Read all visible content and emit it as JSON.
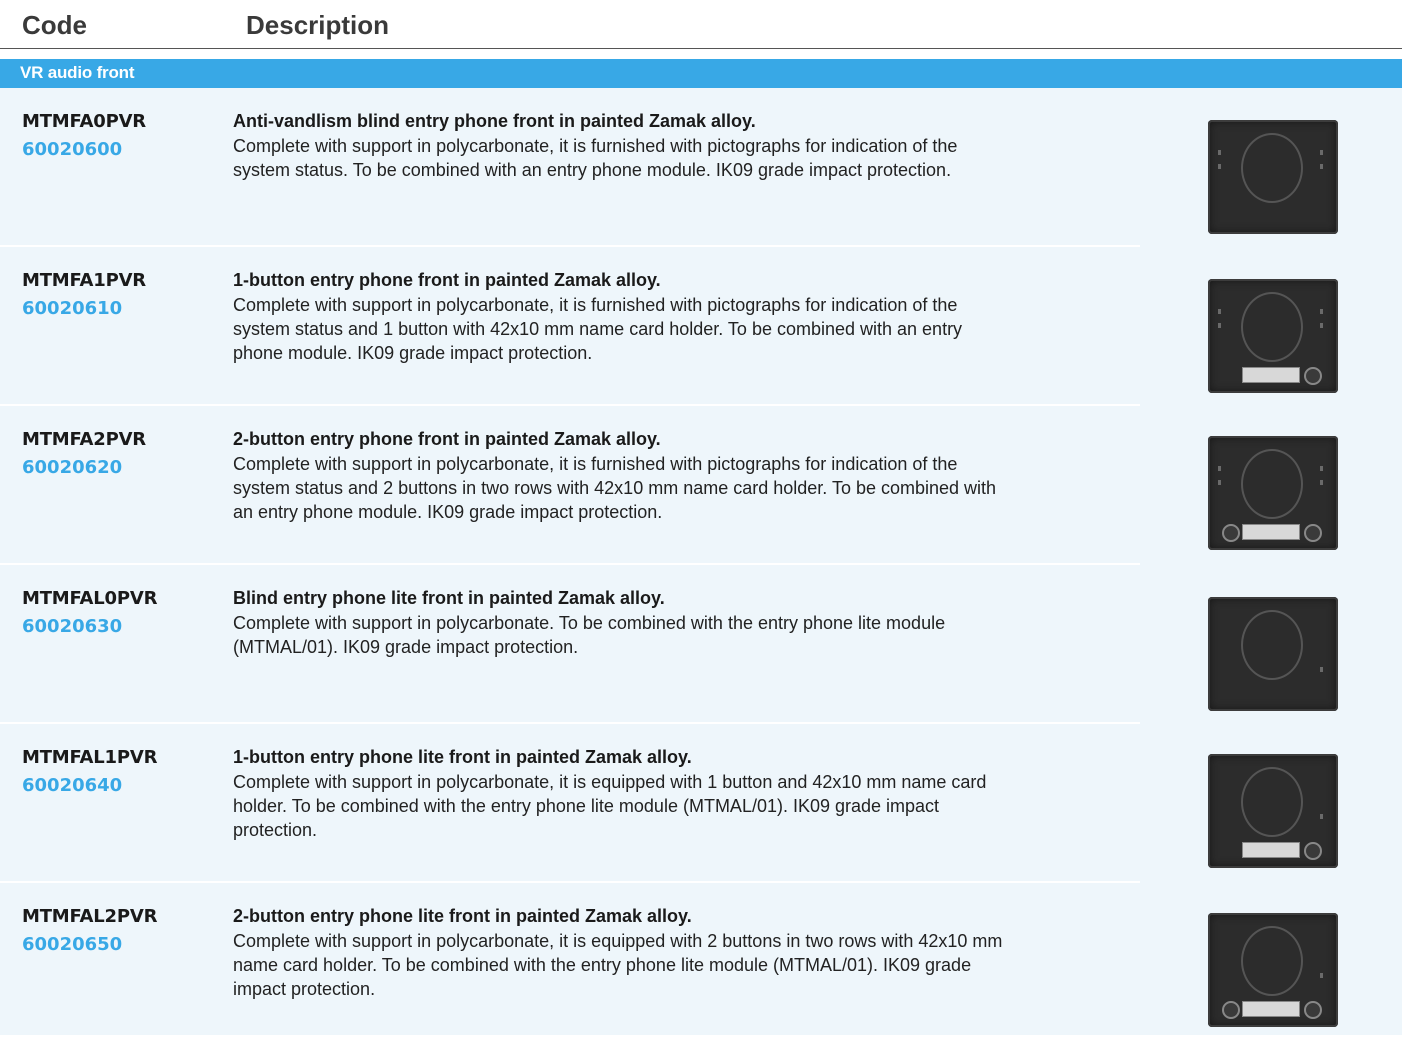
{
  "header": {
    "code_label": "Code",
    "description_label": "Description"
  },
  "section": {
    "title": "VR audio front"
  },
  "products": [
    {
      "code": "MTMFA0PVR",
      "number": "60020600",
      "title": "Anti-vandlism blind entry phone front in painted Zamak alloy.",
      "description": "Complete with support in polycarbonate, it is furnished with pictographs for indication of the system status. To be combined with an entry phone module. IK09 grade impact protection.",
      "image": "blind-front-photo"
    },
    {
      "code": "MTMFA1PVR",
      "number": "60020610",
      "title": "1-button entry phone front in painted Zamak alloy.",
      "description": "Complete with support in polycarbonate, it is furnished with pictographs for indication of the system status and 1 button with 42x10 mm name card holder. To be combined with an entry phone module. IK09 grade impact protection.",
      "image": "one-button-front-photo"
    },
    {
      "code": "MTMFA2PVR",
      "number": "60020620",
      "title": "2-button entry phone front in painted Zamak alloy.",
      "description": "Complete with support in polycarbonate, it is furnished with pictographs for indication of the system status and 2 buttons in two rows with 42x10 mm name card holder. To be combined with an entry phone module. IK09 grade impact protection.",
      "image": "two-button-front-photo"
    },
    {
      "code": "MTMFAL0PVR",
      "number": "60020630",
      "title": "Blind entry phone lite front in painted Zamak alloy.",
      "description": "Complete with support in polycarbonate. To be combined with the entry phone lite module (MTMAL/01). IK09 grade impact protection.",
      "image": "blind-lite-front-photo"
    },
    {
      "code": "MTMFAL1PVR",
      "number": "60020640",
      "title": "1-button entry phone lite front in painted Zamak alloy.",
      "description": "Complete with support in polycarbonate, it is equipped with 1 button and 42x10 mm name card holder. To be combined with the entry phone lite module (MTMAL/01). IK09 grade impact protection.",
      "image": "one-button-lite-front-photo"
    },
    {
      "code": "MTMFAL2PVR",
      "number": "60020650",
      "title": "2-button entry phone lite front in painted Zamak alloy.",
      "description": "Complete with support in polycarbonate, it is equipped with 2 buttons in two rows with 42x10 mm name card holder. To be combined with the entry phone lite module (MTMAL/01). IK09 grade impact protection.",
      "image": "two-button-lite-front-photo"
    }
  ]
}
